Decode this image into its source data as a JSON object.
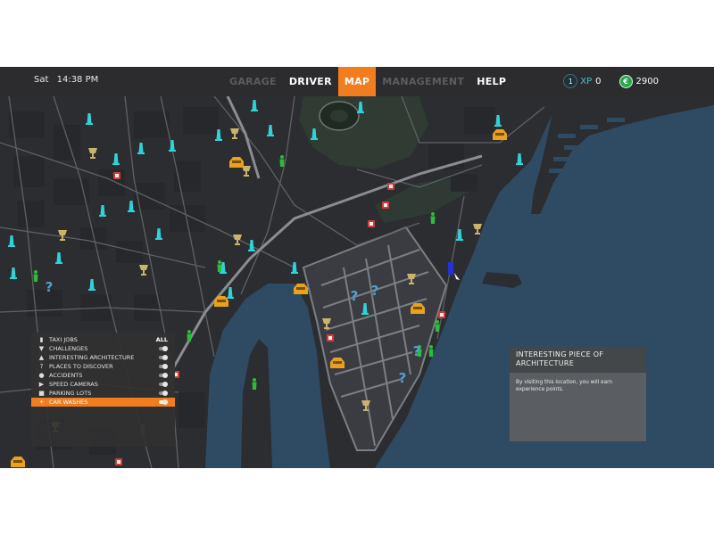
{
  "header": {
    "day": "Sat",
    "time": "14:38 PM",
    "tabs": [
      {
        "label": "GARAGE",
        "state": "disabled"
      },
      {
        "label": "DRIVER",
        "state": "normal"
      },
      {
        "label": "MAP",
        "state": "active"
      },
      {
        "label": "MANAGEMENT",
        "state": "disabled"
      },
      {
        "label": "HELP",
        "state": "normal"
      }
    ],
    "level": "1",
    "xp_label": "XP",
    "xp_value": "0",
    "currency_symbol": "€",
    "money": "2900"
  },
  "legend": {
    "items": [
      {
        "icon": "taxi-icon",
        "label": "TAXI JOBS",
        "control": "ALL",
        "selected": false
      },
      {
        "icon": "trophy-icon",
        "label": "CHALLENGES",
        "control": "toggle",
        "selected": false
      },
      {
        "icon": "tower-icon",
        "label": "INTERESTING ARCHITECTURE",
        "control": "toggle",
        "selected": false
      },
      {
        "icon": "question-icon",
        "label": "PLACES TO DISCOVER",
        "control": "toggle",
        "selected": false
      },
      {
        "icon": "accident-icon",
        "label": "ACCIDENTS",
        "control": "toggle",
        "selected": false
      },
      {
        "icon": "camera-icon",
        "label": "SPEED CAMERAS",
        "control": "toggle",
        "selected": false
      },
      {
        "icon": "parking-icon",
        "label": "PARKING LOTS",
        "control": "toggle",
        "selected": false
      },
      {
        "icon": "carwash-icon",
        "label": "CAR WASHES",
        "control": "toggle",
        "selected": true
      }
    ]
  },
  "info_panel": {
    "title": "INTERESTING PIECE OF ARCHITECTURE",
    "body": "By visiting this location, you will earn experience points."
  },
  "colors": {
    "accent": "#f27d1f",
    "water": "#2f4a63",
    "land": "#2b2d31",
    "park": "#2f3b33",
    "architecture_marker": "#2fd2d8",
    "challenge_marker": "#c9b46a",
    "taxi_marker": "#e9a21b",
    "people_marker": "#2dbb3c",
    "place_marker": "#4fa0d8",
    "camera_marker": "#d83a3a",
    "player_marker": "#2331d6"
  },
  "map": {
    "markers": {
      "architecture": [
        [
          100,
          135
        ],
        [
          158,
          168
        ],
        [
          130,
          180
        ],
        [
          285,
          120
        ],
        [
          352,
          152
        ],
        [
          404,
          122
        ],
        [
          303,
          148
        ],
        [
          245,
          153
        ],
        [
          193,
          165
        ],
        [
          115,
          238
        ],
        [
          147,
          233
        ],
        [
          178,
          264
        ],
        [
          13,
          272
        ],
        [
          66,
          291
        ],
        [
          15,
          308
        ],
        [
          103,
          321
        ],
        [
          258,
          330
        ],
        [
          250,
          302
        ],
        [
          282,
          277
        ],
        [
          330,
          302
        ],
        [
          409,
          348
        ],
        [
          515,
          265
        ],
        [
          582,
          180
        ],
        [
          558,
          137
        ]
      ],
      "challenges": [
        [
          104,
          172
        ],
        [
          70,
          264
        ],
        [
          161,
          303
        ],
        [
          266,
          269
        ],
        [
          263,
          150
        ],
        [
          276,
          192
        ],
        [
          366,
          363
        ],
        [
          461,
          313
        ],
        [
          535,
          257
        ],
        [
          410,
          455
        ],
        [
          62,
          479
        ]
      ],
      "taxis": [
        [
          265,
          183
        ],
        [
          337,
          325
        ],
        [
          248,
          339
        ],
        [
          378,
          408
        ],
        [
          468,
          347
        ],
        [
          20,
          519
        ],
        [
          560,
          152
        ]
      ],
      "people": [
        [
          316,
          182
        ],
        [
          485,
          246
        ],
        [
          40,
          311
        ],
        [
          212,
          378
        ],
        [
          285,
          432
        ],
        [
          470,
          395
        ],
        [
          483,
          395
        ],
        [
          490,
          367
        ],
        [
          160,
          484
        ],
        [
          246,
          300
        ]
      ],
      "places": [
        [
          55,
          322
        ],
        [
          397,
          332
        ],
        [
          420,
          326
        ],
        [
          467,
          394
        ],
        [
          451,
          424
        ]
      ],
      "cameras": [
        [
          131,
          197
        ],
        [
          438,
          209
        ],
        [
          432,
          230
        ],
        [
          416,
          251
        ],
        [
          495,
          353
        ],
        [
          370,
          379
        ],
        [
          133,
          518
        ],
        [
          197,
          420
        ]
      ],
      "player": [
        [
          505,
          302
        ]
      ]
    }
  }
}
